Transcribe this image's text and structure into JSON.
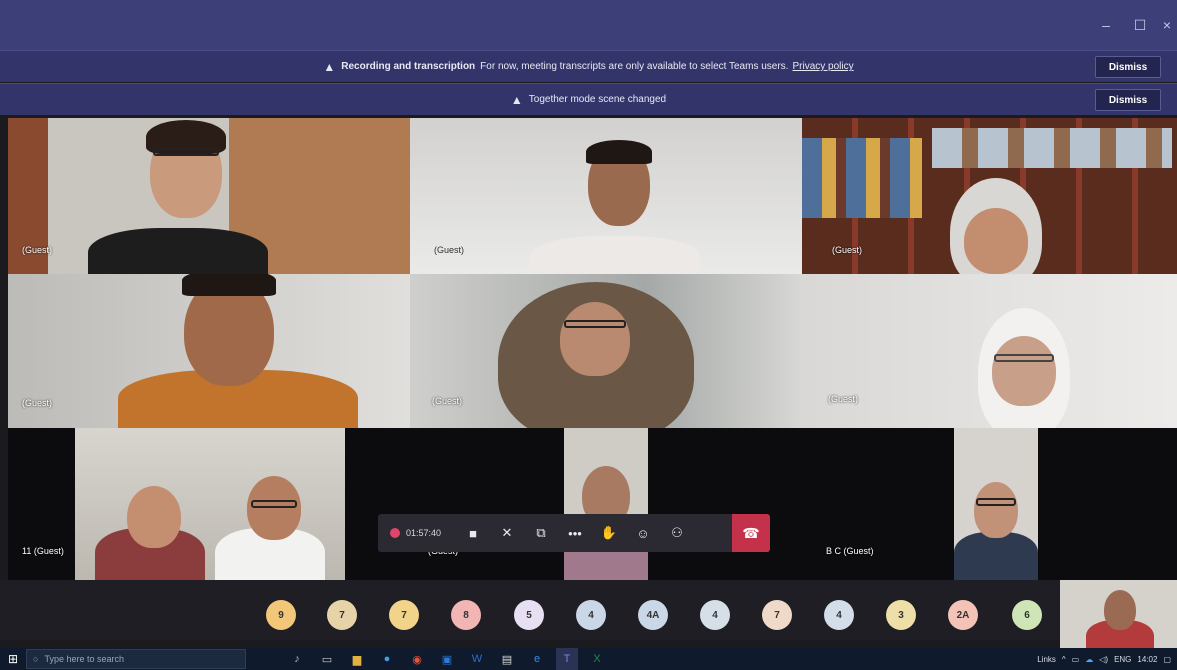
{
  "window": {
    "minimize": "–",
    "maximize": "☐",
    "close": "×"
  },
  "banner1": {
    "bold": "Recording and transcription",
    "text": "For now, meeting transcripts are only available to select Teams users.",
    "link": "Privacy policy",
    "dismiss": "Dismiss"
  },
  "banner2": {
    "text": "Together mode scene changed",
    "dismiss": "Dismiss"
  },
  "tiles": [
    {
      "name": "(Guest)"
    },
    {
      "name": "(Guest)"
    },
    {
      "name": "(Guest)"
    },
    {
      "name": "(Guest)"
    },
    {
      "name": "(Guest)"
    },
    {
      "name": "(Guest)"
    },
    {
      "name": "11 (Guest)"
    },
    {
      "name": "(Guest)"
    },
    {
      "name": "B C (Guest)"
    }
  ],
  "controls": {
    "timer": "01:57:40"
  },
  "avatars": [
    "9",
    "7",
    "7",
    "8",
    "5",
    "4",
    "4A",
    "4",
    "7",
    "4",
    "3",
    "2A",
    "6"
  ],
  "taskbar": {
    "search_placeholder": "Type here to search",
    "lang": "ENG",
    "time": "14:02",
    "links": "Links"
  },
  "colors": {
    "title_bar": "#3d3f79",
    "hangup": "#c4314b",
    "record": "#e0456a"
  }
}
